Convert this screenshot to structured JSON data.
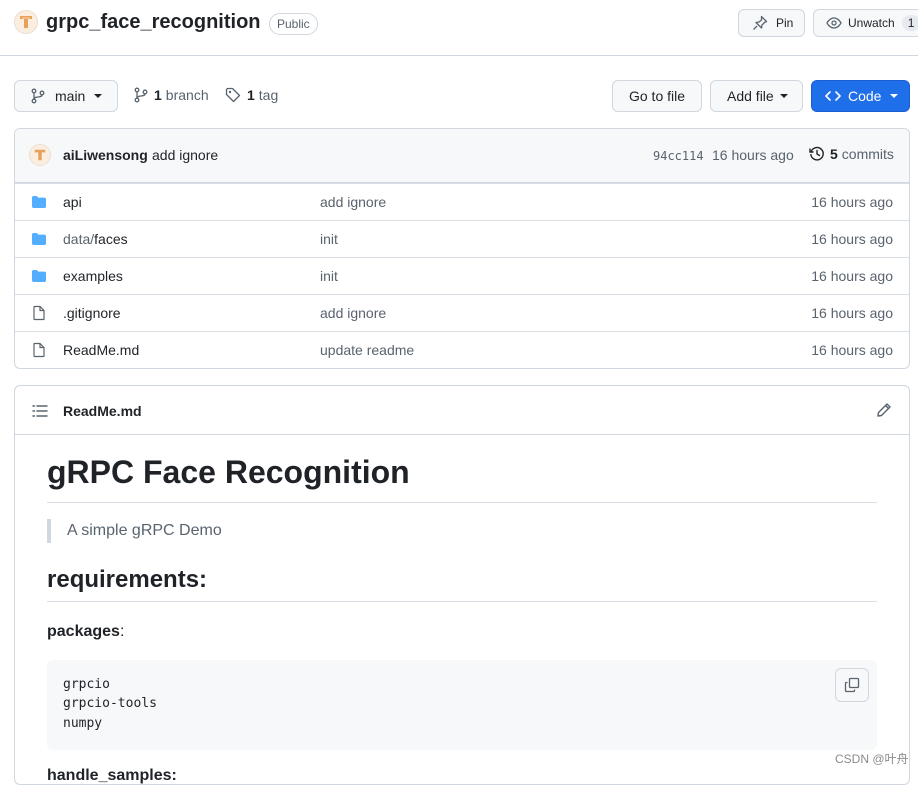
{
  "repo": {
    "name": "grpc_face_recognition",
    "visibility": "Public",
    "avatar_icon": "owner-avatar-icon",
    "pin_label": "Pin",
    "unwatch_label": "Unwatch",
    "watch_count": "1"
  },
  "toolbar": {
    "branch_name": "main",
    "branch_count": "1",
    "branch_word": "branch",
    "tag_count": "1",
    "tag_word": "tag",
    "go_to_file": "Go to file",
    "add_file": "Add file",
    "code": "Code"
  },
  "commit": {
    "author": "aiLiwensong",
    "message": "add ignore",
    "sha": "94cc114",
    "time": "16 hours ago",
    "commits_count": "5",
    "commits_word": "commits"
  },
  "files": [
    {
      "name": "api",
      "prefix": "",
      "type": "folder",
      "message": "add ignore",
      "time": "16 hours ago"
    },
    {
      "name": "faces",
      "prefix": "data/",
      "type": "folder",
      "message": "init",
      "time": "16 hours ago"
    },
    {
      "name": "examples",
      "prefix": "",
      "type": "folder",
      "message": "init",
      "time": "16 hours ago"
    },
    {
      "name": ".gitignore",
      "prefix": "",
      "type": "file",
      "message": "add ignore",
      "time": "16 hours ago"
    },
    {
      "name": "ReadMe.md",
      "prefix": "",
      "type": "file",
      "message": "update readme",
      "time": "16 hours ago"
    }
  ],
  "readme": {
    "filename": "ReadMe.md",
    "h1": "gRPC Face Recognition",
    "quote": "A simple gRPC Demo",
    "h2": "requirements:",
    "packages_label": "packages",
    "packages_suffix": ":",
    "code_lines": [
      "grpcio",
      "grpcio-tools",
      "numpy"
    ],
    "next_heading_partial": "handle_samples:"
  },
  "watermark": "CSDN @叶舟",
  "colors": {
    "accent_blue": "#1f6feb",
    "folder_blue": "#54aeff",
    "text_muted": "#59636e",
    "border": "#d0d7de"
  }
}
